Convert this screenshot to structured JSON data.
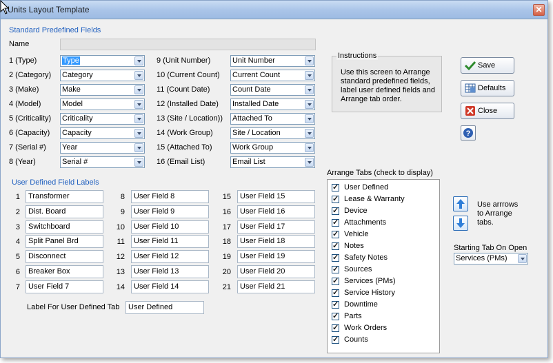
{
  "window": {
    "title": "Units Layout Template"
  },
  "standard_section": {
    "title": "Standard Predefined Fields",
    "name_label": "Name",
    "name_value": ""
  },
  "standard_left": [
    {
      "label": "1 (Type)",
      "value": "Type"
    },
    {
      "label": "2 (Category)",
      "value": "Category"
    },
    {
      "label": "3 (Make)",
      "value": "Make"
    },
    {
      "label": "4 (Model)",
      "value": "Model"
    },
    {
      "label": "5 (Criticality)",
      "value": "Criticality"
    },
    {
      "label": "6 (Capacity)",
      "value": "Capacity"
    },
    {
      "label": "7 (Serial #)",
      "value": "Year"
    },
    {
      "label": "8 (Year)",
      "value": "Serial #"
    }
  ],
  "standard_right": [
    {
      "label": "9 (Unit Number)",
      "value": "Unit Number"
    },
    {
      "label": "10 (Current Count)",
      "value": "Current Count"
    },
    {
      "label": "11 (Count Date)",
      "value": "Count Date"
    },
    {
      "label": "12 (Installed Date)",
      "value": "Installed Date"
    },
    {
      "label": "13 (Site / Location))",
      "value": "Attached To"
    },
    {
      "label": "14 (Work Group)",
      "value": "Site / Location"
    },
    {
      "label": "15 (Attached To)",
      "value": "Work Group"
    },
    {
      "label": "16 (Email List)",
      "value": "Email List"
    }
  ],
  "instructions": {
    "title": "Instructions",
    "text": "Use this screen to Arrange standard predefined fields, label user defined fields and Arrange tab order."
  },
  "buttons": {
    "save": "Save",
    "defaults": "Defaults",
    "close": "Close"
  },
  "user_section": {
    "title": "User Defined Field Labels"
  },
  "user_fields": [
    {
      "num": "1",
      "value": "Transformer"
    },
    {
      "num": "2",
      "value": "Dist. Board"
    },
    {
      "num": "3",
      "value": "Switchboard"
    },
    {
      "num": "4",
      "value": "Split Panel Brd"
    },
    {
      "num": "5",
      "value": "Disconnect"
    },
    {
      "num": "6",
      "value": "Breaker Box"
    },
    {
      "num": "7",
      "value": "User Field 7"
    },
    {
      "num": "8",
      "value": "User Field 8"
    },
    {
      "num": "9",
      "value": "User Field 9"
    },
    {
      "num": "10",
      "value": "User Field 10"
    },
    {
      "num": "11",
      "value": "User Field 11"
    },
    {
      "num": "12",
      "value": "User Field 12"
    },
    {
      "num": "13",
      "value": "User Field 13"
    },
    {
      "num": "14",
      "value": "User Field 14"
    },
    {
      "num": "15",
      "value": "User Field 15"
    },
    {
      "num": "16",
      "value": "User Field 16"
    },
    {
      "num": "17",
      "value": "User Field 17"
    },
    {
      "num": "18",
      "value": "User Field 18"
    },
    {
      "num": "19",
      "value": "User Field 19"
    },
    {
      "num": "20",
      "value": "User Field 20"
    },
    {
      "num": "21",
      "value": "User Field 21"
    }
  ],
  "user_tab": {
    "label": "Label For User Defined Tab",
    "value": "User Defined"
  },
  "arrange_tabs": {
    "title": "Arrange Tabs (check to display)",
    "items": [
      {
        "label": "User Defined",
        "checked": true
      },
      {
        "label": "Lease & Warranty",
        "checked": true
      },
      {
        "label": "Device",
        "checked": true
      },
      {
        "label": "Attachments",
        "checked": true
      },
      {
        "label": "Vehicle",
        "checked": true
      },
      {
        "label": "Notes",
        "checked": true
      },
      {
        "label": "Safety Notes",
        "checked": true
      },
      {
        "label": "Sources",
        "checked": true
      },
      {
        "label": "Services (PMs)",
        "checked": true
      },
      {
        "label": "Service History",
        "checked": true
      },
      {
        "label": "Downtime",
        "checked": true
      },
      {
        "label": "Parts",
        "checked": true
      },
      {
        "label": "Work Orders",
        "checked": true
      },
      {
        "label": "Counts",
        "checked": true
      }
    ]
  },
  "arrows_hint": "Use arrrows to Arrange tabs.",
  "starting_tab": {
    "label": "Starting Tab On Open",
    "value": "Services (PMs)"
  },
  "colors": {
    "section_title": "#1f5fbf",
    "selection": "#3399ff",
    "titlebar": "#a9c4e8"
  }
}
